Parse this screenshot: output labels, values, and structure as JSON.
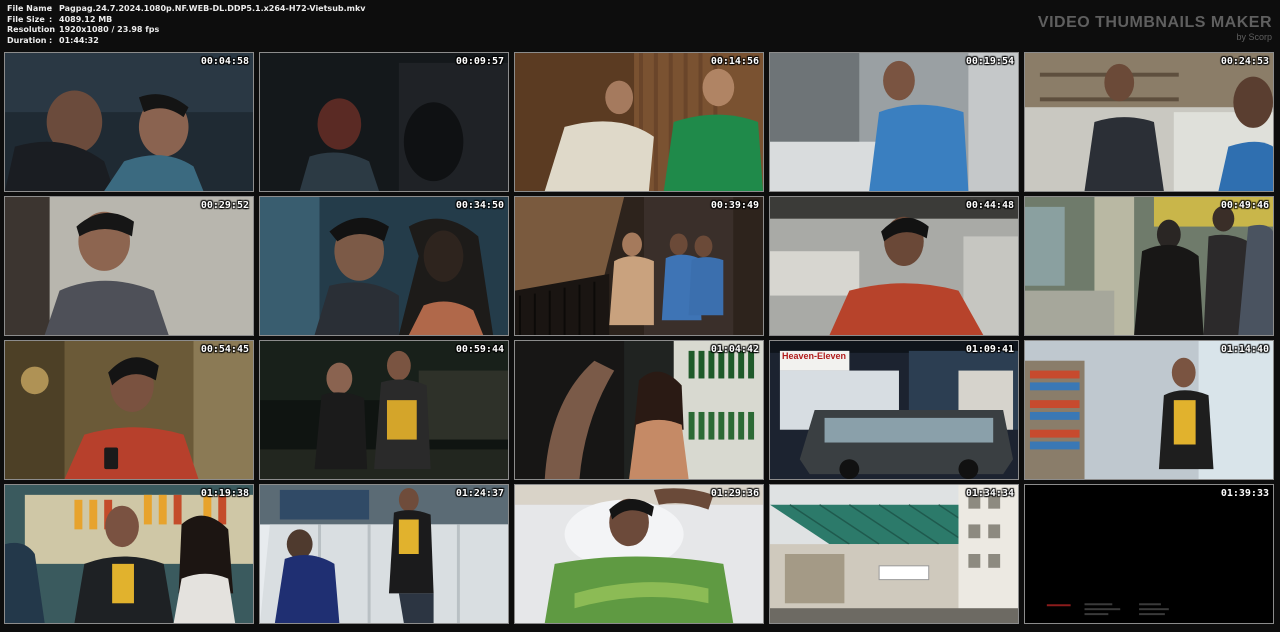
{
  "file_info": {
    "rows": [
      {
        "key": "File Name",
        "value": "Pagpag.24.7.2024.1080p.NF.WEB-DL.DDP5.1.x264-H72-Vietsub.mkv"
      },
      {
        "key": "File Size",
        "value": "4089.12 MB"
      },
      {
        "key": "Resolution",
        "value": "1920x1080 / 23.98 fps"
      },
      {
        "key": "Duration",
        "value": "01:44:32"
      }
    ]
  },
  "brand": {
    "title": "VIDEO THUMBNAILS MAKER",
    "subtitle": "by Scorp"
  },
  "thumbnails": [
    {
      "time": "00:04:58"
    },
    {
      "time": "00:09:57"
    },
    {
      "time": "00:14:56"
    },
    {
      "time": "00:19:54"
    },
    {
      "time": "00:24:53"
    },
    {
      "time": "00:29:52"
    },
    {
      "time": "00:34:50"
    },
    {
      "time": "00:39:49"
    },
    {
      "time": "00:44:48"
    },
    {
      "time": "00:49:46"
    },
    {
      "time": "00:54:45"
    },
    {
      "time": "00:59:44"
    },
    {
      "time": "01:04:42"
    },
    {
      "time": "01:09:41"
    },
    {
      "time": "01:14:40"
    },
    {
      "time": "01:19:38"
    },
    {
      "time": "01:24:37"
    },
    {
      "time": "01:29:36"
    },
    {
      "time": "01:34:34"
    },
    {
      "time": "01:39:33"
    }
  ],
  "signage": {
    "store_name": "Heaven-Eleven"
  }
}
